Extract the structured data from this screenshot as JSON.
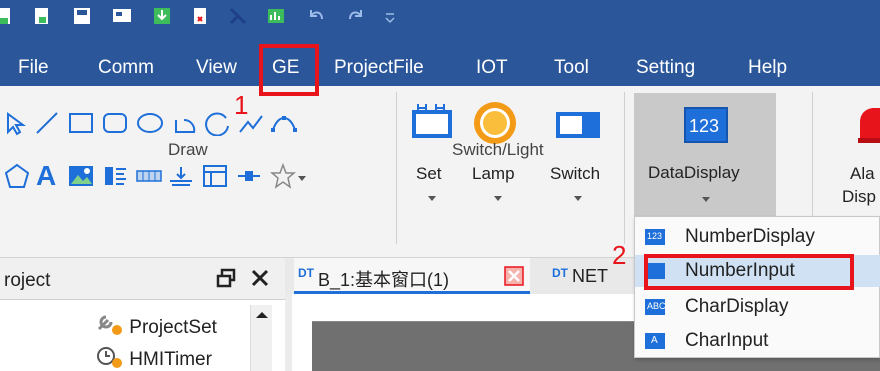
{
  "menu": {
    "items": [
      "File",
      "Comm",
      "View",
      "GE",
      "ProjectFile",
      "IOT",
      "Tool",
      "Setting",
      "Help"
    ],
    "active_index": 3
  },
  "annotations": {
    "step1": "1",
    "step2": "2"
  },
  "ribbon": {
    "draw_label": "Draw",
    "switch_light_label": "Switch/Light",
    "set_label": "Set",
    "lamp_label": "Lamp",
    "switch_label": "Switch",
    "datadisplay_label": "DataDisplay",
    "datadisplay_icon_text": "123",
    "alarm_label_line1": "Ala",
    "alarm_label_line2": "Disp",
    "text_tool_glyph": "A"
  },
  "project_panel": {
    "title": "roject",
    "tree": [
      "ProjectSet",
      "HMITimer"
    ]
  },
  "doc_tabs": [
    {
      "label": "B_1:基本窗口(1)"
    },
    {
      "label": "NET"
    }
  ],
  "dropdown": {
    "items": [
      {
        "icon_text": "123",
        "label": "NumberDisplay"
      },
      {
        "icon_text": "",
        "label": "NumberInput"
      },
      {
        "icon_text": "ABC",
        "label": "CharDisplay"
      },
      {
        "icon_text": "A",
        "label": "CharInput"
      }
    ],
    "highlighted_index": 1
  },
  "colors": {
    "menubar": "#2b579a",
    "highlight": "#e8141b",
    "hover": "#cfe1f3",
    "icon_blue": "#1e6fd9"
  }
}
